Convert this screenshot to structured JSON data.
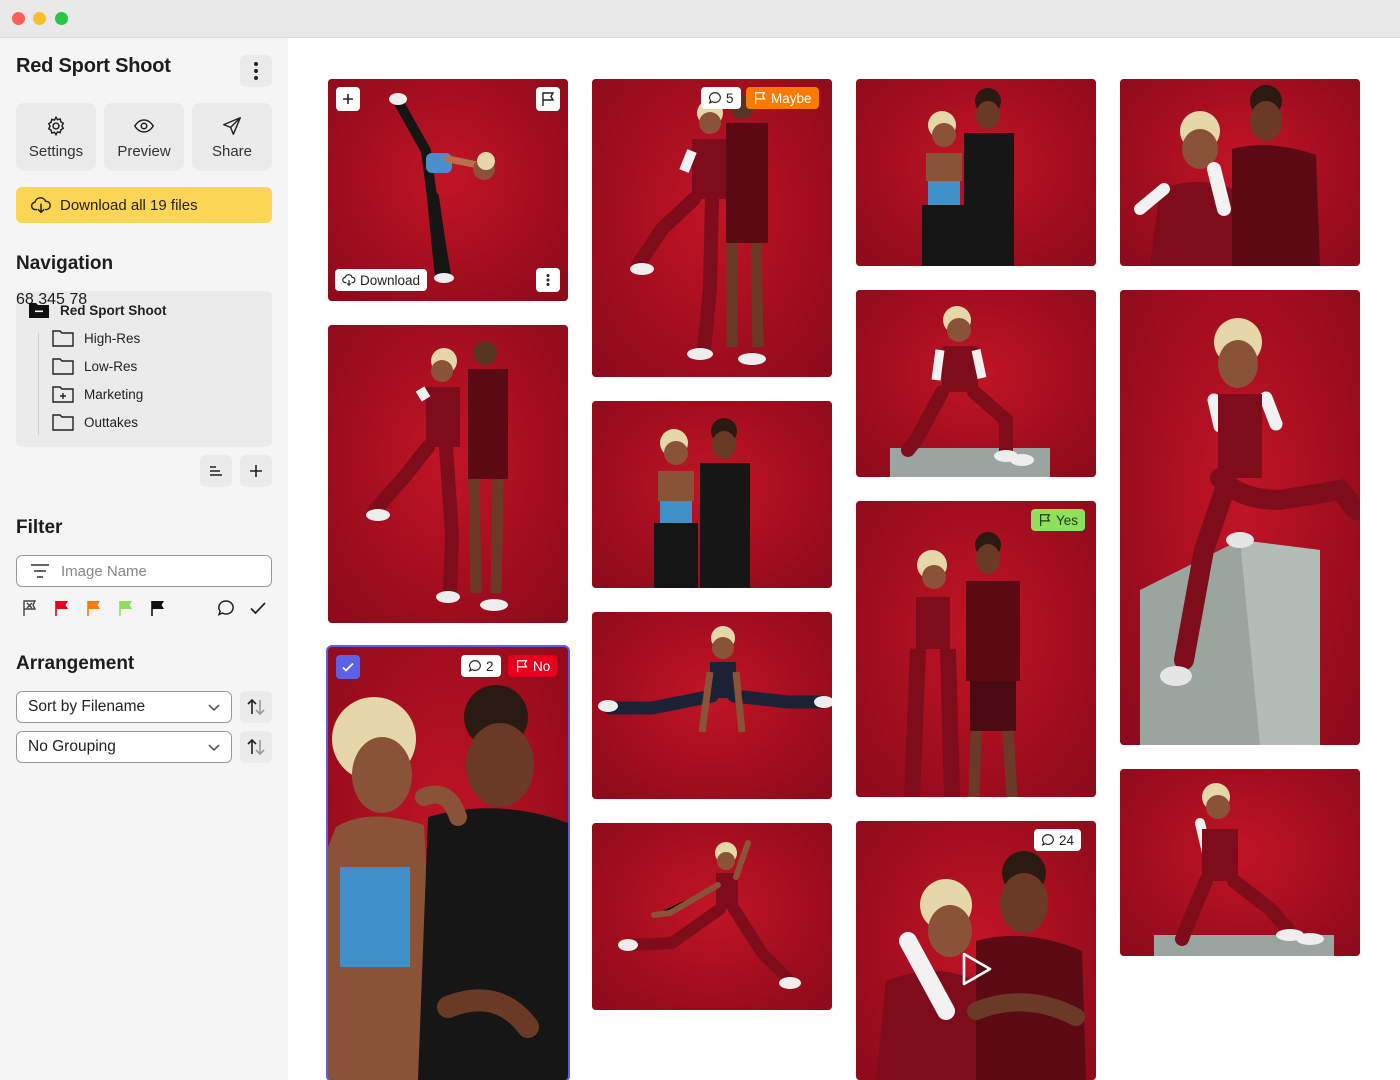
{
  "window": {
    "title": "Red Sport Shoot"
  },
  "sidebar": {
    "title": "Red Sport Shoot",
    "tools": [
      {
        "label": "Settings",
        "icon": "gear-icon"
      },
      {
        "label": "Preview",
        "icon": "eye-icon"
      },
      {
        "label": "Share",
        "icon": "send-icon"
      }
    ],
    "download_all_label": "Download all 19 files",
    "navigation": {
      "title": "Navigation",
      "root": "Red Sport Shoot",
      "folders": [
        {
          "name": "High-Res",
          "count": "68"
        },
        {
          "name": "Low-Res",
          "count": "345"
        },
        {
          "name": "Marketing",
          "count": ""
        },
        {
          "name": "Outtakes",
          "count": "78"
        }
      ]
    },
    "filter": {
      "title": "Filter",
      "placeholder": "Image Name",
      "flag_colors": [
        "#e8001c",
        "#fb7a00",
        "#8ee05a",
        "#111111"
      ]
    },
    "arrangement": {
      "title": "Arrangement",
      "sort": "Sort by Filename",
      "grouping": "No Grouping"
    }
  },
  "gallery": {
    "download_label": "Download",
    "badges": {
      "t2_comments": "5",
      "t2_flag": "Maybe",
      "t6_comments": "2",
      "t6_flag": "No",
      "t9_flag": "Yes",
      "t10_comments": "24"
    }
  },
  "colors": {
    "accent": "#fdd554",
    "selection": "#5b5fe8",
    "photo_bg": "#a80e20"
  }
}
